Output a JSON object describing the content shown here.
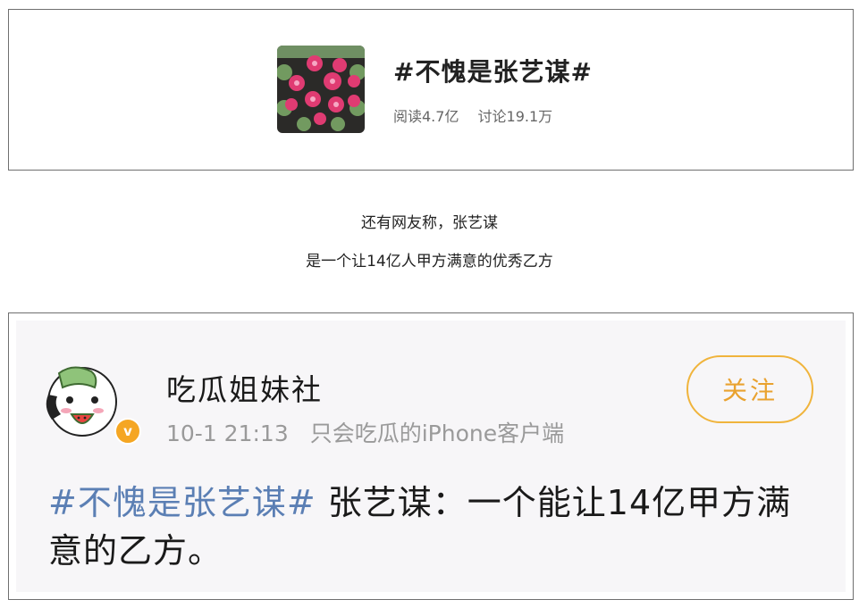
{
  "topic": {
    "title": "#不愧是张艺谋#",
    "reads": "阅读4.7亿",
    "discussions": "讨论19.1万"
  },
  "caption": {
    "line1": "还有网友称，张艺谋",
    "line2": "是一个让14亿人甲方满意的优秀乙方"
  },
  "post": {
    "username": "吃瓜姐妹社",
    "time": "10-1 21:13",
    "source": "只会吃瓜的iPhone客户端",
    "follow_label": "关注",
    "verify_mark": "v",
    "hashtag": "#不愧是张艺谋#",
    "body": " 张艺谋：一个能让14亿甲方满意的乙方。"
  },
  "colors": {
    "hashtag": "#5b7fb4",
    "follow": "#e9a22f",
    "badge": "#f5a623"
  },
  "icons": {
    "topic_image": "fireworks-image",
    "avatar": "cartoon-avatar-with-watermelon",
    "verify": "verified-badge-icon"
  }
}
